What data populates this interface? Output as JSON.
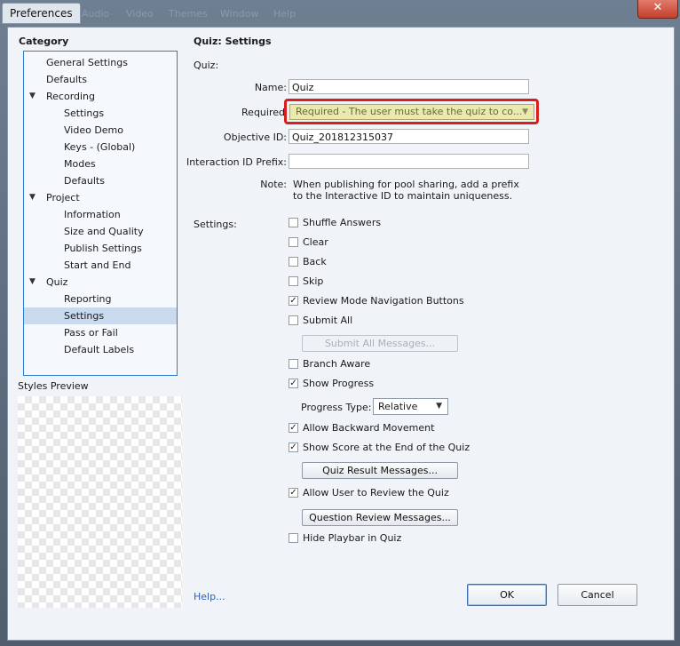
{
  "window": {
    "title": "Preferences",
    "menu_ghost": [
      "Audio",
      "Video",
      "Themes",
      "Window",
      "Help"
    ],
    "close_glyph": "✕"
  },
  "sidebar": {
    "heading": "Category",
    "items": [
      {
        "label": "General Settings",
        "level": 1,
        "expanded": null,
        "selected": false
      },
      {
        "label": "Defaults",
        "level": 1,
        "expanded": null,
        "selected": false
      },
      {
        "label": "Recording",
        "level": 1,
        "expanded": true,
        "selected": false
      },
      {
        "label": "Settings",
        "level": 2,
        "expanded": null,
        "selected": false
      },
      {
        "label": "Video Demo",
        "level": 2,
        "expanded": null,
        "selected": false
      },
      {
        "label": "Keys - (Global)",
        "level": 2,
        "expanded": null,
        "selected": false
      },
      {
        "label": "Modes",
        "level": 2,
        "expanded": null,
        "selected": false
      },
      {
        "label": "Defaults",
        "level": 2,
        "expanded": null,
        "selected": false
      },
      {
        "label": "Project",
        "level": 1,
        "expanded": true,
        "selected": false
      },
      {
        "label": "Information",
        "level": 2,
        "expanded": null,
        "selected": false
      },
      {
        "label": "Size and Quality",
        "level": 2,
        "expanded": null,
        "selected": false
      },
      {
        "label": "Publish Settings",
        "level": 2,
        "expanded": null,
        "selected": false
      },
      {
        "label": "Start and End",
        "level": 2,
        "expanded": null,
        "selected": false
      },
      {
        "label": "Quiz",
        "level": 1,
        "expanded": true,
        "selected": false
      },
      {
        "label": "Reporting",
        "level": 2,
        "expanded": null,
        "selected": false
      },
      {
        "label": "Settings",
        "level": 2,
        "expanded": null,
        "selected": true
      },
      {
        "label": "Pass or Fail",
        "level": 2,
        "expanded": null,
        "selected": false
      },
      {
        "label": "Default Labels",
        "level": 2,
        "expanded": null,
        "selected": false
      }
    ],
    "arrow_glyph": "▼",
    "styles_preview_label": "Styles Preview"
  },
  "main": {
    "title": "Quiz: Settings",
    "section_quiz": "Quiz:",
    "name_label": "Name:",
    "name_value": "Quiz",
    "required_label": "Required",
    "required_value": "Required - The user must take the quiz to co...",
    "dropdown_glyph": "▼",
    "objective_label": "Objective ID:",
    "objective_value": "Quiz_201812315037",
    "interaction_label": "Interaction ID Prefix:",
    "interaction_value": "",
    "note_label": "Note:",
    "note_line1": "When publishing for pool sharing, add a prefix",
    "note_line2": "to the Interactive ID to maintain uniqueness.",
    "settings_label": "Settings:",
    "check_glyph": "✓",
    "options": {
      "shuffle": {
        "label": "Shuffle Answers",
        "checked": false
      },
      "clear": {
        "label": "Clear",
        "checked": false
      },
      "back": {
        "label": "Back",
        "checked": false
      },
      "skip": {
        "label": "Skip",
        "checked": false
      },
      "review_nav": {
        "label": "Review Mode Navigation Buttons",
        "checked": true
      },
      "submit_all": {
        "label": "Submit All",
        "checked": false
      },
      "branch_aware": {
        "label": "Branch Aware",
        "checked": false
      },
      "show_progress": {
        "label": "Show Progress",
        "checked": true
      },
      "allow_backward": {
        "label": "Allow Backward Movement",
        "checked": true
      },
      "show_score": {
        "label": "Show Score at the End of the Quiz",
        "checked": true
      },
      "allow_review": {
        "label": "Allow User to Review the Quiz",
        "checked": true
      },
      "hide_playbar": {
        "label": "Hide Playbar in Quiz",
        "checked": false
      }
    },
    "submit_all_messages_button": "Submit All Messages...",
    "progress_type_label": "Progress Type:",
    "progress_type_value": "Relative",
    "quiz_result_messages_button": "Quiz Result Messages...",
    "question_review_messages_button": "Question Review Messages..."
  },
  "footer": {
    "help_link": "Help...",
    "ok_button": "OK",
    "cancel_button": "Cancel"
  },
  "colors": {
    "accent_border": "#2f7bd1",
    "highlight_red": "#d91e1e",
    "required_bg": "#eaeab0",
    "selected_row": "#c9d9ee",
    "link": "#2a62b8"
  }
}
